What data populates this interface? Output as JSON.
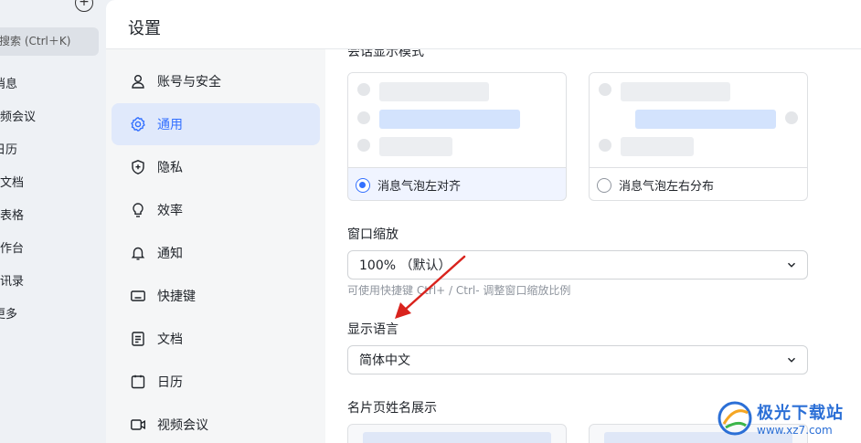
{
  "background_app": {
    "search_placeholder": "搜索 (Ctrl＋K)",
    "items": [
      "消息",
      "视频会议",
      "日历",
      "云文档",
      "多维表格",
      "工作台",
      "通讯录",
      "更多"
    ]
  },
  "window": {
    "title": "设置"
  },
  "nav": {
    "items": [
      {
        "label": "账号与安全",
        "icon": "user-icon",
        "active": false
      },
      {
        "label": "通用",
        "icon": "gear-icon",
        "active": true
      },
      {
        "label": "隐私",
        "icon": "shield-icon",
        "active": false
      },
      {
        "label": "效率",
        "icon": "lightbulb-icon",
        "active": false
      },
      {
        "label": "通知",
        "icon": "bell-icon",
        "active": false
      },
      {
        "label": "快捷键",
        "icon": "keyboard-icon",
        "active": false
      },
      {
        "label": "文档",
        "icon": "document-icon",
        "active": false
      },
      {
        "label": "日历",
        "icon": "calendar-icon",
        "active": false
      },
      {
        "label": "视频会议",
        "icon": "video-icon",
        "active": false
      }
    ]
  },
  "content": {
    "cut_heading": "会话显示模式",
    "layout_options": [
      {
        "label": "消息气泡左对齐",
        "selected": true
      },
      {
        "label": "消息气泡左右分布",
        "selected": false
      }
    ],
    "window_zoom": {
      "label": "窗口缩放",
      "value": "100% （默认）",
      "hint": "可使用快捷键 Ctrl+ / Ctrl- 调整窗口缩放比例"
    },
    "display_language": {
      "label": "显示语言",
      "value": "简体中文"
    },
    "name_display": {
      "label": "名片页姓名展示"
    }
  },
  "annotation": {
    "color": "#d9231d"
  },
  "watermark": {
    "name": "极光下载站",
    "url": "www.xz7.com"
  },
  "colors": {
    "accent": "#3370ff",
    "active_bg": "#e0e9fb"
  }
}
